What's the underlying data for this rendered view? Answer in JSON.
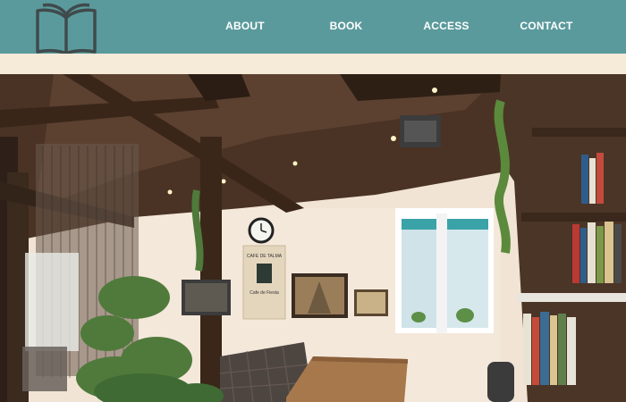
{
  "header": {
    "logo_icon": "open-book-icon",
    "nav": [
      {
        "label": "ABOUT"
      },
      {
        "label": "BOOK"
      },
      {
        "label": "ACCESS"
      },
      {
        "label": "CONTACT"
      }
    ]
  },
  "hero": {
    "image_description_icon": "cafe-interior-photo",
    "poster_text": [
      "CAFE DE TALMA",
      "Cafe de Fiesta"
    ]
  },
  "colors": {
    "header_bg": "#5b9a9c",
    "strip_bg": "#f6ead8",
    "nav_text": "#ffffff"
  }
}
